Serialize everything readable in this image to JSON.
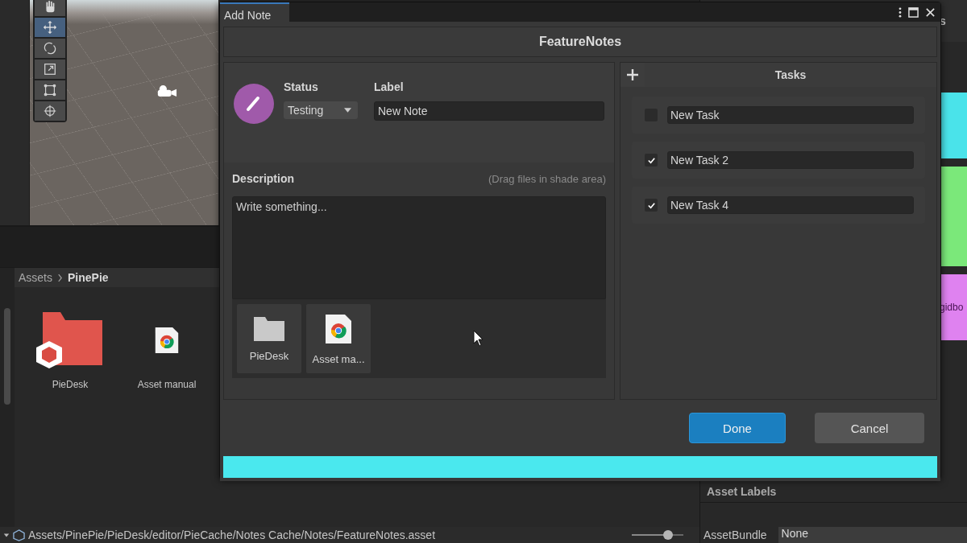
{
  "scene": {
    "tools": [
      {
        "kind": "hand",
        "selected": false
      },
      {
        "kind": "move",
        "selected": true
      },
      {
        "kind": "rotate",
        "selected": false
      },
      {
        "kind": "scale",
        "selected": false
      },
      {
        "kind": "rect",
        "selected": false
      },
      {
        "kind": "transform",
        "selected": false
      }
    ]
  },
  "project": {
    "breadcrumb": [
      "Assets",
      "PinePie"
    ],
    "assets": [
      {
        "name": "PieDesk",
        "kind": "folder"
      },
      {
        "name": "Asset manual",
        "kind": "web"
      }
    ],
    "path": "Assets/PinePie/PieDesk/editor/PieCache/Notes Cache/Notes/FeatureNotes.asset",
    "zoom": {
      "level": 0.7
    }
  },
  "inspector": {
    "heading": "s",
    "cards": [
      {
        "color": "#4ae3ea"
      },
      {
        "color": "#7be87a"
      },
      {
        "color": "#df82f0",
        "text": "gidbo"
      }
    ],
    "asset_labels": "Asset Labels",
    "asset_bundle_label": "AssetBundle",
    "asset_bundle_value": "None"
  },
  "dialog": {
    "tab": "Add Note",
    "title": "FeatureNotes",
    "status_label": "Status",
    "status_value": "Testing",
    "label_label": "Label",
    "label_value": "New Note",
    "description_label": "Description",
    "description_hint": "(Drag files in shade area)",
    "description_placeholder": "Write something...",
    "attachments": [
      {
        "name": "PieDesk",
        "kind": "folder"
      },
      {
        "name": "Asset ma...",
        "kind": "web"
      }
    ],
    "tasks_title": "Tasks",
    "tasks": [
      {
        "text": "New Task",
        "checked": false
      },
      {
        "text": "New Task 2",
        "checked": true
      },
      {
        "text": "New Task 4",
        "checked": true
      }
    ],
    "buttons": [
      {
        "label": "Done",
        "kind": "primary"
      },
      {
        "label": "Cancel",
        "kind": "secondary"
      }
    ]
  }
}
